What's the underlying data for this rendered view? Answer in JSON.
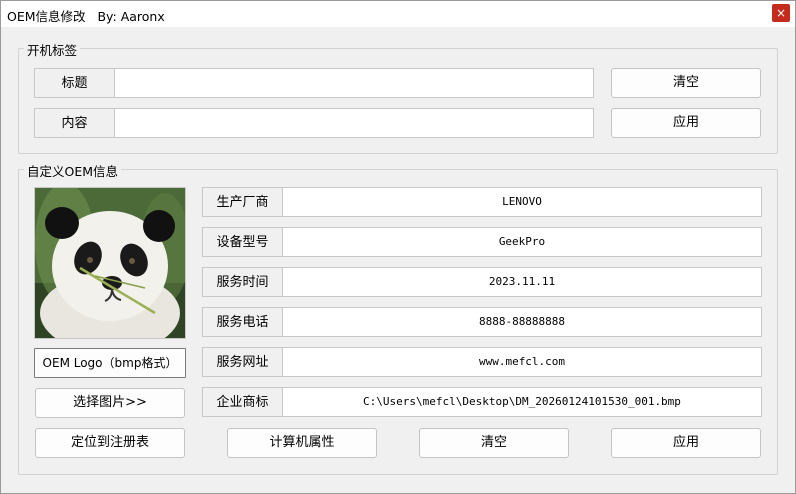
{
  "window": {
    "title": "OEM信息修改   By: Aaronx",
    "close_label": "×"
  },
  "boot_group": {
    "label": "开机标签",
    "title_label": "标题",
    "title_value": "",
    "content_label": "内容",
    "content_value": "",
    "clear_button": "清空",
    "apply_button": "应用"
  },
  "oem_group": {
    "label": "自定义OEM信息",
    "logo_caption": "OEM Logo（bmp格式）",
    "select_image_button": "选择图片>>",
    "fields": [
      {
        "label": "生产厂商",
        "value": "LENOVO"
      },
      {
        "label": "设备型号",
        "value": "GeekPro"
      },
      {
        "label": "服务时间",
        "value": "2023.11.11"
      },
      {
        "label": "服务电话",
        "value": "8888-88888888"
      },
      {
        "label": "服务网址",
        "value": "www.mefcl.com"
      },
      {
        "label": "企业商标",
        "value": "C:\\Users\\mefcl\\Desktop\\DM_20260124101530_001.bmp"
      }
    ],
    "buttons": {
      "locate_registry": "定位到注册表",
      "computer_properties": "计算机属性",
      "clear": "清空",
      "apply": "应用"
    }
  }
}
